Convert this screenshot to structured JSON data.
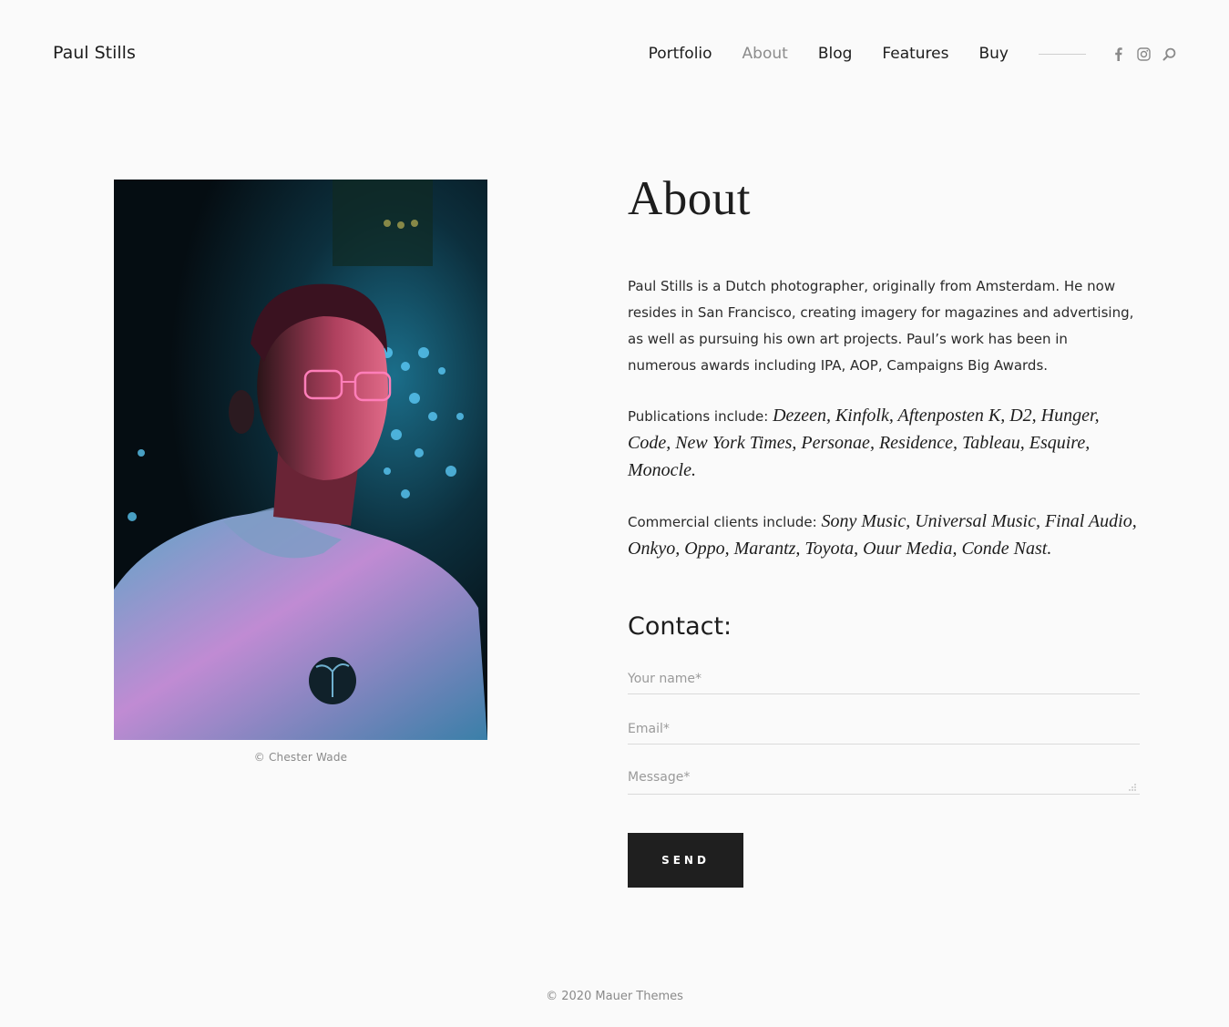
{
  "header": {
    "site_title": "Paul Stills",
    "nav": [
      {
        "label": "Portfolio",
        "active": false
      },
      {
        "label": "About",
        "active": true
      },
      {
        "label": "Blog",
        "active": false
      },
      {
        "label": "Features",
        "active": false
      },
      {
        "label": "Buy",
        "active": false
      }
    ],
    "social_icons": [
      "facebook-icon",
      "instagram-icon",
      "search-icon"
    ]
  },
  "photo": {
    "caption": "© Chester Wade"
  },
  "about": {
    "title": "About",
    "bio": "Paul Stills is a Dutch photographer, originally from Amsterdam. He now resides in San Francisco, creating imagery for magazines and advertising, as well as pursuing his own art projects. Paul’s work has been in numerous awards including IPA, AOP, Campaigns Big Awards.",
    "publications_label": "Publications include:",
    "publications": "Dezeen, Kinfolk, Aftenposten K, D2, Hunger, Code, New York Times, Personae, Residence, Tableau, Esquire, Monocle.",
    "clients_label": "Commercial clients include:",
    "clients": "Sony Music, Universal Music, Final Audio, Onkyo, Oppo, Marantz, Toyota, Ouur Media, Conde Nast."
  },
  "contact": {
    "title": "Contact:",
    "name_placeholder": "Your name*",
    "email_placeholder": "Email*",
    "message_placeholder": "Message*",
    "send_label": "SEND"
  },
  "footer": {
    "copyright": "© 2020 Mauer Themes"
  },
  "colors": {
    "background": "#fafafa",
    "text": "#1d1d1d",
    "muted": "#8c8c8c",
    "button": "#1f1f1f"
  }
}
